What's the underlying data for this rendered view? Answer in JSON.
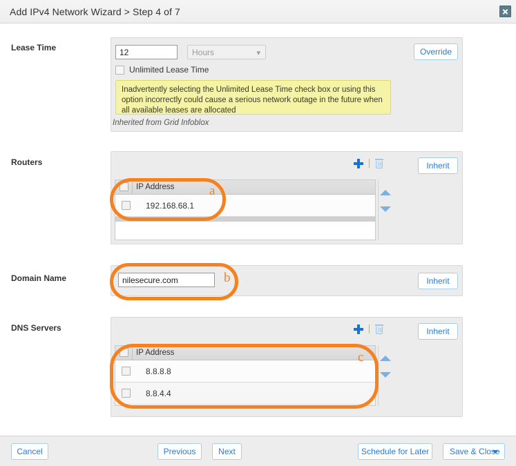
{
  "window": {
    "title": "Add IPv4 Network Wizard > Step 4 of 7",
    "close_label": "close-icon"
  },
  "help_rail": {
    "help_label": "?",
    "collapse_label": "«"
  },
  "sections": {
    "lease_time": {
      "label": "Lease Time",
      "value": "12",
      "unit_selected": "Hours",
      "unlimited_label": "Unlimited Lease Time",
      "warning": "Inadvertently selecting the Unlimited Lease Time check box or using this option incorrectly could cause a serious network outage in the future when all available leases are allocated",
      "inherited_note": "Inherited from Grid Infoblox",
      "override_label": "Override"
    },
    "routers": {
      "label": "Routers",
      "inherit_label": "Inherit",
      "column_header": "IP Address",
      "rows": [
        "192.168.68.1"
      ]
    },
    "domain_name": {
      "label": "Domain Name",
      "value": "nilesecure.com",
      "inherit_label": "Inherit"
    },
    "dns_servers": {
      "label": "DNS Servers",
      "inherit_label": "Inherit",
      "column_header": "IP Address",
      "rows": [
        "8.8.8.8",
        "8.8.4.4"
      ]
    }
  },
  "annotations": {
    "a": "a",
    "b": "b",
    "c": "c",
    "color": "#f58220"
  },
  "footer": {
    "cancel": "Cancel",
    "previous": "Previous",
    "next": "Next",
    "schedule": "Schedule for Later",
    "save_close": "Save & Close"
  }
}
